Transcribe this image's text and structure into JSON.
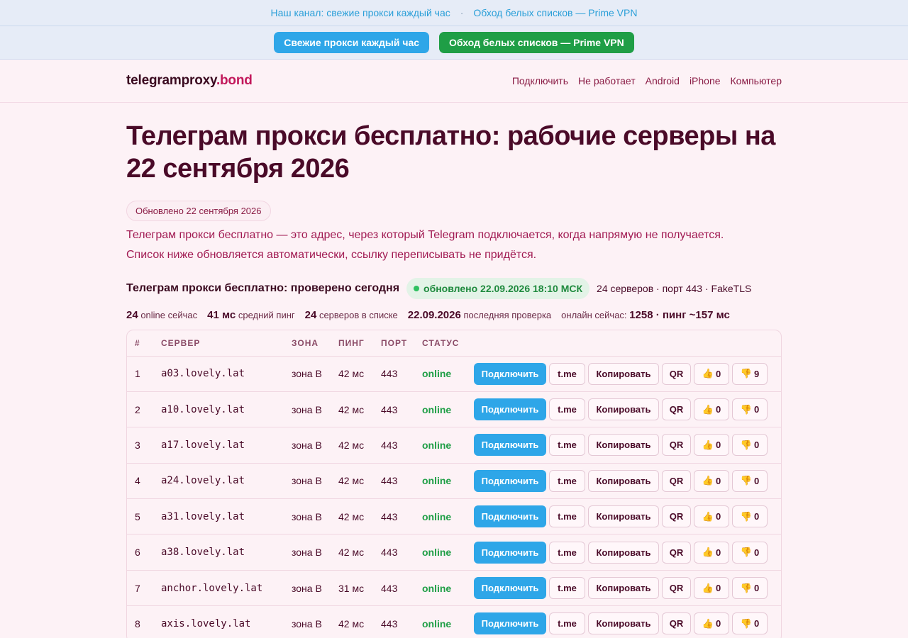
{
  "topbar": {
    "channel_link": "Наш канал: свежие прокси каждый час",
    "separator": "·",
    "vpn_link": "Обход белых списков — Prime VPN"
  },
  "promo": {
    "fresh_button": "Свежие прокси каждый час",
    "vpn_button": "Обход белых списков — Prime VPN"
  },
  "header": {
    "logo_main": "telegramproxy",
    "logo_tld": ".bond",
    "nav": [
      "Подключить",
      "Не работает",
      "Android",
      "iPhone",
      "Компьютер"
    ]
  },
  "main": {
    "title": "Телеграм прокси бесплатно: рабочие серверы на 22 сентября 2026",
    "updated": "Обновлено 22 сентября 2026",
    "intro_line1": "Телеграм прокси бесплатно — это адрес, через который Telegram подключается, когда напрямую не получается.",
    "intro_line2": "Список ниже обновляется автоматически, ссылку переписывать не придётся."
  },
  "status": {
    "title": "Телеграм прокси бесплатно: проверено сегодня",
    "pill": "обновлено 22.09.2026 18:10 МСК",
    "meta": "24 серверов · порт 443 · FakeTLS"
  },
  "stats": {
    "online_value": "24",
    "online_label": "online сейчас",
    "ping_value": "41 мс",
    "ping_label": "средний пинг",
    "servers_value": "24",
    "servers_label": "серверов в списке",
    "check_value": "22.09.2026",
    "check_label": "последняя проверка",
    "now_label": "онлайн сейчас:",
    "now_value": "1258 · пинг ~157 мс"
  },
  "table": {
    "headers": [
      "#",
      "СЕРВЕР",
      "ЗОНА",
      "ПИНГ",
      "ПОРТ",
      "СТАТУС",
      ""
    ],
    "action_labels": {
      "connect": "Подключить",
      "tme": "t.me",
      "copy": "Копировать",
      "qr": "QR"
    },
    "rows": [
      {
        "n": "1",
        "server": "a03.lovely.lat",
        "zone": "зона B",
        "ping": "42 мс",
        "port": "443",
        "status": "online",
        "likes": "0",
        "dislikes": "9"
      },
      {
        "n": "2",
        "server": "a10.lovely.lat",
        "zone": "зона B",
        "ping": "42 мс",
        "port": "443",
        "status": "online",
        "likes": "0",
        "dislikes": "0"
      },
      {
        "n": "3",
        "server": "a17.lovely.lat",
        "zone": "зона B",
        "ping": "42 мс",
        "port": "443",
        "status": "online",
        "likes": "0",
        "dislikes": "0"
      },
      {
        "n": "4",
        "server": "a24.lovely.lat",
        "zone": "зона B",
        "ping": "42 мс",
        "port": "443",
        "status": "online",
        "likes": "0",
        "dislikes": "0"
      },
      {
        "n": "5",
        "server": "a31.lovely.lat",
        "zone": "зона B",
        "ping": "42 мс",
        "port": "443",
        "status": "online",
        "likes": "0",
        "dislikes": "0"
      },
      {
        "n": "6",
        "server": "a38.lovely.lat",
        "zone": "зона B",
        "ping": "42 мс",
        "port": "443",
        "status": "online",
        "likes": "0",
        "dislikes": "0"
      },
      {
        "n": "7",
        "server": "anchor.lovely.lat",
        "zone": "зона B",
        "ping": "31 мс",
        "port": "443",
        "status": "online",
        "likes": "0",
        "dislikes": "0"
      },
      {
        "n": "8",
        "server": "axis.lovely.lat",
        "zone": "зона B",
        "ping": "42 мс",
        "port": "443",
        "status": "online",
        "likes": "0",
        "dislikes": "0"
      }
    ]
  }
}
